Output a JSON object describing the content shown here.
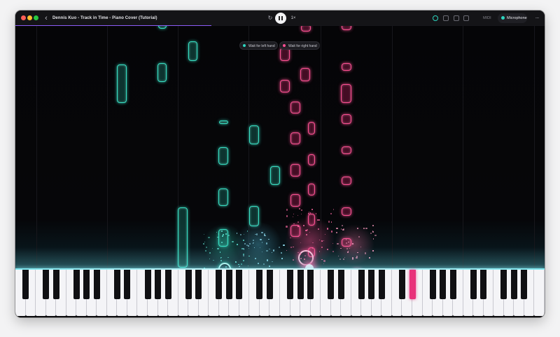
{
  "window": {
    "title": "Dennis Kuo - Track in Time - Piano Cover (Tutorial)",
    "progress_fraction": 0.37
  },
  "controls": {
    "restart_icon": "restart-icon",
    "back_icon": "chevron-left-icon",
    "back_glyph": "‹",
    "restart_glyph": "↻",
    "speed_label": "1×",
    "midi_label": "MIDI",
    "microphone_label": "Microphone",
    "more_glyph": "···"
  },
  "wait_buttons": {
    "left_hand": "Wait for left hand",
    "right_hand": "Wait for right hand"
  },
  "colors": {
    "left_hand": "#37e0c4",
    "right_hand": "#ff4f93",
    "progress": "#8b5cf6",
    "active_key": "#e8317a"
  },
  "keyboard": {
    "active_black_key_index": 27
  }
}
